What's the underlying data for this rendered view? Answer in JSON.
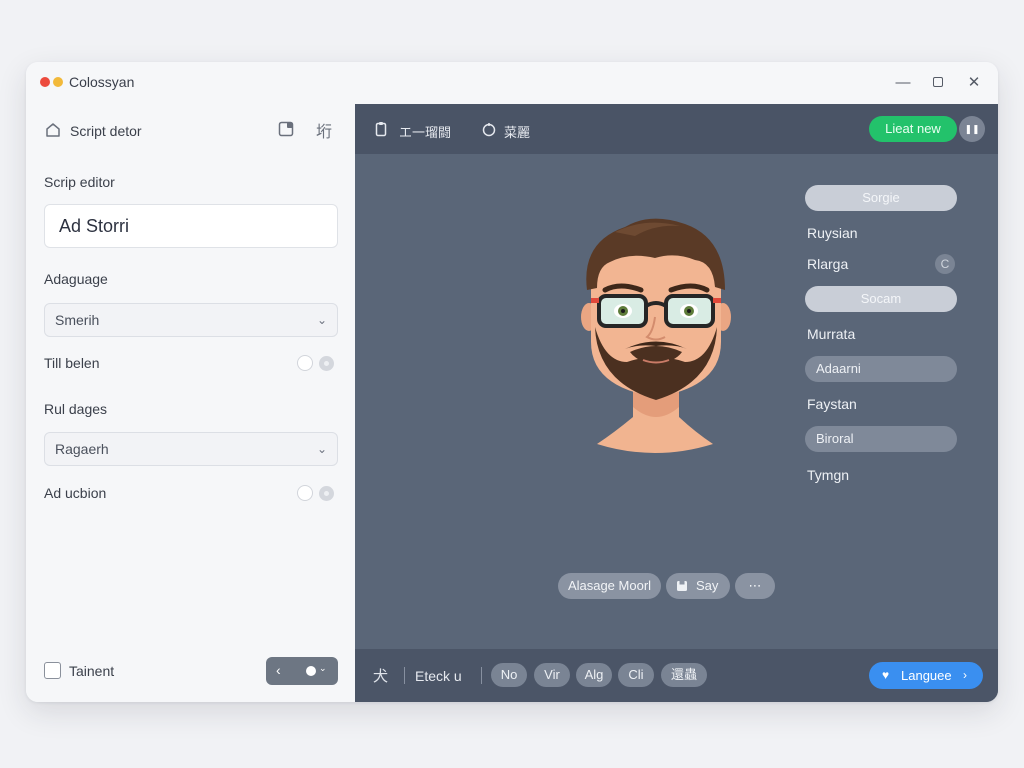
{
  "window": {
    "title": "Colossyan",
    "controls": {
      "minimize": "—",
      "close": "✕"
    }
  },
  "left_panel": {
    "header_title": "Script detor",
    "header_tool2_glyph": "垳",
    "script_label": "Scrip editor",
    "script_value": "Ad Storri",
    "language_label": "Adaguage",
    "language_value": "Smerih",
    "toggle1_label": "Till belen",
    "rules_label": "Rul dages",
    "rules_value": "Ragaerh",
    "toggle2_label": "Ad ucbion",
    "checkbox_label": "Tainent",
    "nav_back": "‹",
    "nav_dropdown": "⌄"
  },
  "toolbar": {
    "item1_label": "エ一瑠闘",
    "item2_label": "菜麗",
    "live_label": "Lieat new",
    "pause_label": "❚❚"
  },
  "options": {
    "pill1": "Sorgie",
    "text1": "Ruysian",
    "text2": "Rlarga",
    "ring_glyph": "C",
    "pill2": "Socam",
    "text3": "Murrata",
    "pill3": "Adaarni",
    "text4": "Faystan",
    "pill4": "Biroral",
    "text5": "Tymgn"
  },
  "chips": {
    "chip1": "Alasage Moorl",
    "chip2": "Say",
    "chip3": "⋯"
  },
  "bottom_bar": {
    "icon_glyph": "犬",
    "label": "Eteck u",
    "chips": [
      "No",
      "Vir",
      "Alg",
      "Cli",
      "還蟲"
    ],
    "language_button": "Languee",
    "language_arrow": "›"
  },
  "colors": {
    "live_green": "#23c26b",
    "language_blue": "#3a8ff0",
    "canvas_bg": "#5a6678"
  }
}
